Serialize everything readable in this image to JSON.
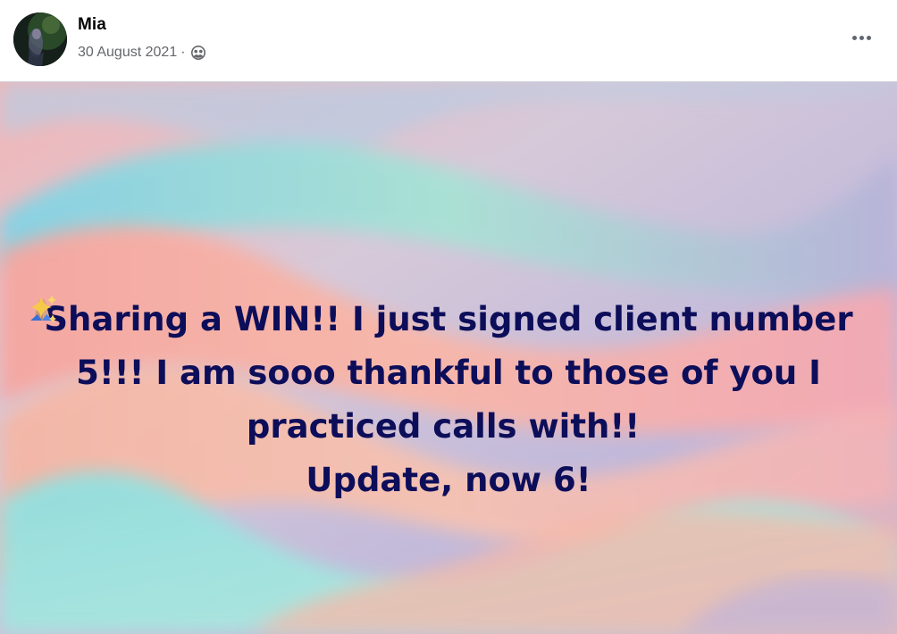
{
  "post": {
    "author": "Mia",
    "date": "30 August 2021",
    "separator": "·",
    "audience_icon": "friends-icon",
    "more_icon": "more-options-icon",
    "text_lines": [
      "Sharing a WIN!! I just signed client number",
      "5!!! I am sooo thankful to those of you I",
      "practiced calls with!!",
      "Update, now 6!"
    ],
    "emojis": [
      "folded-hands-icon",
      "sparkles-icon"
    ]
  },
  "colors": {
    "text": "#0d0e5a",
    "name": "#050505",
    "meta": "#65676b",
    "bg_pink": "#f7a7a8",
    "bg_teal": "#8ed8d8",
    "bg_lavender": "#c8b6d8"
  }
}
